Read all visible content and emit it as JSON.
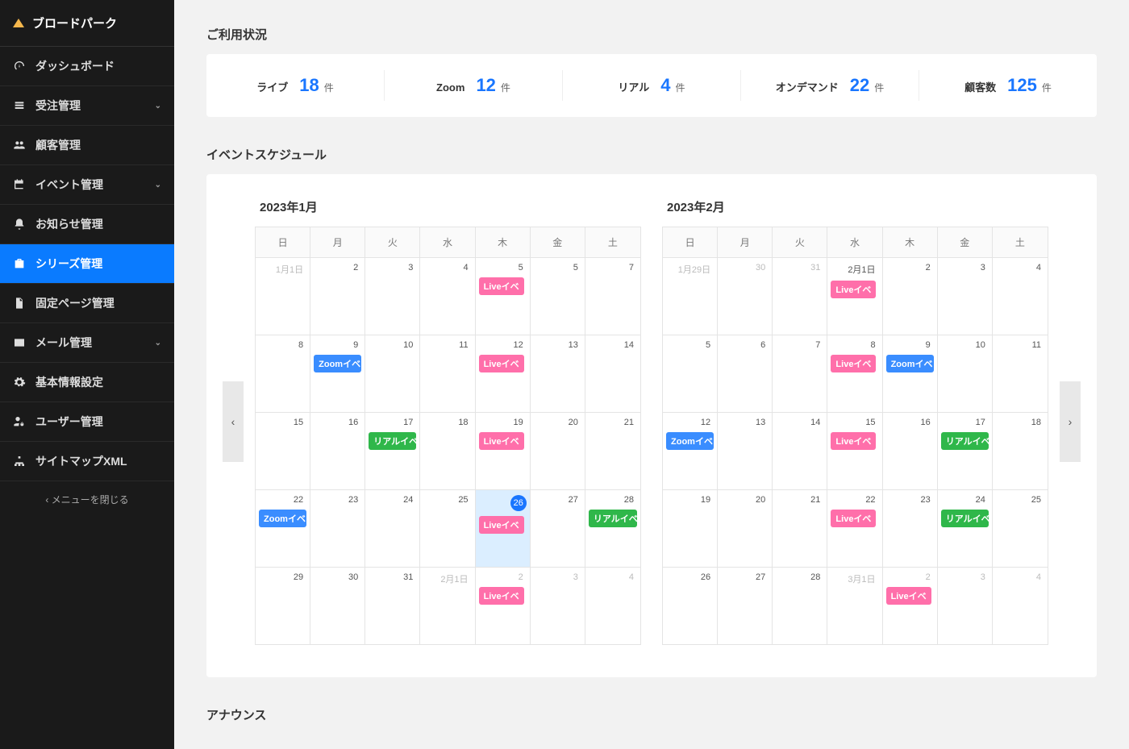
{
  "brand": "ブロードパーク",
  "sidebar": {
    "items": [
      {
        "label": "ダッシュボード",
        "icon": "gauge",
        "expandable": false,
        "active": false
      },
      {
        "label": "受注管理",
        "icon": "list",
        "expandable": true,
        "active": false
      },
      {
        "label": "顧客管理",
        "icon": "users",
        "expandable": false,
        "active": false
      },
      {
        "label": "イベント管理",
        "icon": "calendar",
        "expandable": true,
        "active": false
      },
      {
        "label": "お知らせ管理",
        "icon": "bell",
        "expandable": false,
        "active": false
      },
      {
        "label": "シリーズ管理",
        "icon": "briefcase",
        "expandable": false,
        "active": true
      },
      {
        "label": "固定ページ管理",
        "icon": "file",
        "expandable": false,
        "active": false
      },
      {
        "label": "メール管理",
        "icon": "mail",
        "expandable": true,
        "active": false
      },
      {
        "label": "基本情報設定",
        "icon": "gear",
        "expandable": false,
        "active": false
      },
      {
        "label": "ユーザー管理",
        "icon": "user-cog",
        "expandable": false,
        "active": false
      },
      {
        "label": "サイトマップXML",
        "icon": "sitemap",
        "expandable": false,
        "active": false
      }
    ],
    "close_label": "メニューを閉じる"
  },
  "sections": {
    "usage_title": "ご利用状況",
    "schedule_title": "イベントスケジュール",
    "announce_title": "アナウンス"
  },
  "stats": [
    {
      "label": "ライブ",
      "value": "18",
      "unit": "件"
    },
    {
      "label": "Zoom",
      "value": "12",
      "unit": "件"
    },
    {
      "label": "リアル",
      "value": "4",
      "unit": "件"
    },
    {
      "label": "オンデマンド",
      "value": "22",
      "unit": "件"
    },
    {
      "label": "顧客数",
      "value": "125",
      "unit": "件"
    }
  ],
  "weekdays": [
    "日",
    "月",
    "火",
    "水",
    "木",
    "金",
    "土"
  ],
  "event_labels": {
    "live": "Liveイベ",
    "zoom": "Zoomイベ",
    "real": "リアルイベ"
  },
  "calendars": [
    {
      "title": "2023年1月",
      "cells": [
        {
          "d": "1月1日",
          "dim": true
        },
        {
          "d": "2"
        },
        {
          "d": "3"
        },
        {
          "d": "4"
        },
        {
          "d": "5",
          "ev": [
            "live"
          ]
        },
        {
          "d": "5"
        },
        {
          "d": "7"
        },
        {
          "d": "8"
        },
        {
          "d": "9",
          "ev": [
            "zoom"
          ]
        },
        {
          "d": "10"
        },
        {
          "d": "11"
        },
        {
          "d": "12",
          "ev": [
            "live"
          ]
        },
        {
          "d": "13"
        },
        {
          "d": "14"
        },
        {
          "d": "15"
        },
        {
          "d": "16"
        },
        {
          "d": "17",
          "ev": [
            "real"
          ]
        },
        {
          "d": "18"
        },
        {
          "d": "19",
          "ev": [
            "live"
          ]
        },
        {
          "d": "20"
        },
        {
          "d": "21"
        },
        {
          "d": "22",
          "ev": [
            "zoom"
          ]
        },
        {
          "d": "23"
        },
        {
          "d": "24"
        },
        {
          "d": "25"
        },
        {
          "d": "26",
          "today": true,
          "ev": [
            "live"
          ]
        },
        {
          "d": "27"
        },
        {
          "d": "28",
          "ev": [
            "real"
          ]
        },
        {
          "d": "29"
        },
        {
          "d": "30"
        },
        {
          "d": "31"
        },
        {
          "d": "2月1日",
          "dim": true
        },
        {
          "d": "2",
          "dim": true,
          "ev": [
            "live"
          ]
        },
        {
          "d": "3",
          "dim": true
        },
        {
          "d": "4",
          "dim": true
        }
      ]
    },
    {
      "title": "2023年2月",
      "cells": [
        {
          "d": "1月29日",
          "dim": true
        },
        {
          "d": "30",
          "dim": true
        },
        {
          "d": "31",
          "dim": true
        },
        {
          "d": "2月1日",
          "ev": [
            "live"
          ]
        },
        {
          "d": "2"
        },
        {
          "d": "3"
        },
        {
          "d": "4"
        },
        {
          "d": "5"
        },
        {
          "d": "6"
        },
        {
          "d": "7"
        },
        {
          "d": "8",
          "ev": [
            "live"
          ]
        },
        {
          "d": "9",
          "ev": [
            "zoom"
          ]
        },
        {
          "d": "10"
        },
        {
          "d": "11"
        },
        {
          "d": "12",
          "ev": [
            "zoom"
          ]
        },
        {
          "d": "13"
        },
        {
          "d": "14"
        },
        {
          "d": "15",
          "ev": [
            "live"
          ]
        },
        {
          "d": "16"
        },
        {
          "d": "17",
          "ev": [
            "real"
          ]
        },
        {
          "d": "18"
        },
        {
          "d": "19"
        },
        {
          "d": "20"
        },
        {
          "d": "21"
        },
        {
          "d": "22",
          "ev": [
            "live"
          ]
        },
        {
          "d": "23"
        },
        {
          "d": "24",
          "ev": [
            "real"
          ]
        },
        {
          "d": "25"
        },
        {
          "d": "26"
        },
        {
          "d": "27"
        },
        {
          "d": "28"
        },
        {
          "d": "3月1日",
          "dim": true
        },
        {
          "d": "2",
          "dim": true,
          "ev": [
            "live"
          ]
        },
        {
          "d": "3",
          "dim": true
        },
        {
          "d": "4",
          "dim": true
        }
      ]
    }
  ]
}
